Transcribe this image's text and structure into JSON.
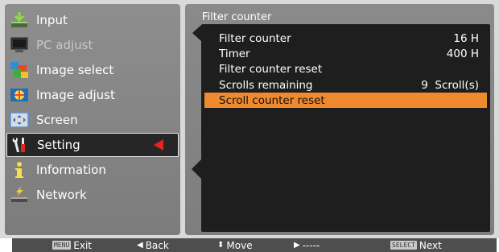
{
  "menu": {
    "items": [
      {
        "label": "Input",
        "icon": "input-icon",
        "dimmed": false,
        "selected": false
      },
      {
        "label": "PC adjust",
        "icon": "pc-adjust-icon",
        "dimmed": true,
        "selected": false
      },
      {
        "label": "Image select",
        "icon": "image-select-icon",
        "dimmed": false,
        "selected": false
      },
      {
        "label": "Image adjust",
        "icon": "image-adjust-icon",
        "dimmed": false,
        "selected": false
      },
      {
        "label": "Screen",
        "icon": "screen-icon",
        "dimmed": false,
        "selected": false
      },
      {
        "label": "Setting",
        "icon": "setting-icon",
        "dimmed": false,
        "selected": true
      },
      {
        "label": "Information",
        "icon": "information-icon",
        "dimmed": false,
        "selected": false
      },
      {
        "label": "Network",
        "icon": "network-icon",
        "dimmed": false,
        "selected": false
      }
    ]
  },
  "submenu": {
    "title": "Filter counter",
    "rows": [
      {
        "label": "Filter counter",
        "value": "16 H"
      },
      {
        "label": "Timer",
        "value": "400 H"
      },
      {
        "label": "Filter counter reset",
        "value": ""
      },
      {
        "label": "Scrolls remaining",
        "value": "9  Scroll(s)"
      },
      {
        "label": "Scroll counter reset",
        "value": ""
      }
    ],
    "highlighted_index": 4
  },
  "hints": {
    "exit_key": "MENU",
    "exit_label": "Exit",
    "back_label": "Back",
    "move_label": "Move",
    "next_dash_label": "-----",
    "select_key": "SELECT",
    "next_label": "Next"
  },
  "colors": {
    "highlight": "#ef8a2e",
    "selection_arrow": "#e3271e"
  }
}
